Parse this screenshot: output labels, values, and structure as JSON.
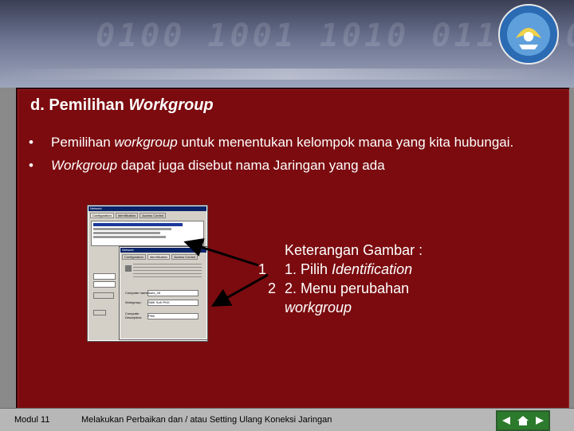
{
  "slide": {
    "title_prefix": "d. Pemilihan ",
    "title_italic": "Workgroup",
    "bullets": [
      {
        "pre": "Pemilihan ",
        "italic": "workgroup",
        "post": " untuk menentukan kelompok mana yang kita hubungai."
      },
      {
        "pre": "",
        "italic": "Workgroup",
        "post": " dapat juga disebut nama Jaringan yang ada"
      }
    ],
    "bullet_symbol": "•",
    "caption": {
      "heading": "Keterangan Gambar :",
      "items": [
        {
          "num": "1",
          "pre": "1. Pilih ",
          "italic": "Identification"
        },
        {
          "num": "2",
          "pre": "2. Menu perubahan",
          "italic": "workgroup"
        }
      ]
    }
  },
  "screenshot": {
    "window1_title": "Network",
    "tabs1": [
      "Configuration",
      "Identification",
      "Access Control"
    ],
    "window2_title": "Network",
    "tabs2": [
      "Configuration",
      "Identification",
      "Access Control"
    ],
    "fields": [
      "Computer name:",
      "Workgroup:",
      "Computer Description:"
    ],
    "field_values": [
      "ksed_26",
      "SMK SoH PKK",
      "PNK"
    ]
  },
  "footer": {
    "module": "Modul 11",
    "description": "Melakukan Perbaikan dan / atau Setting Ulang Koneksi Jaringan"
  },
  "icons": [
    "back-icon",
    "home-icon",
    "forward-icon",
    "logo-icon"
  ],
  "colors": {
    "panel": "#7b0b0f",
    "footer": "#b7b7b7",
    "nav": "#2c7a2c"
  }
}
